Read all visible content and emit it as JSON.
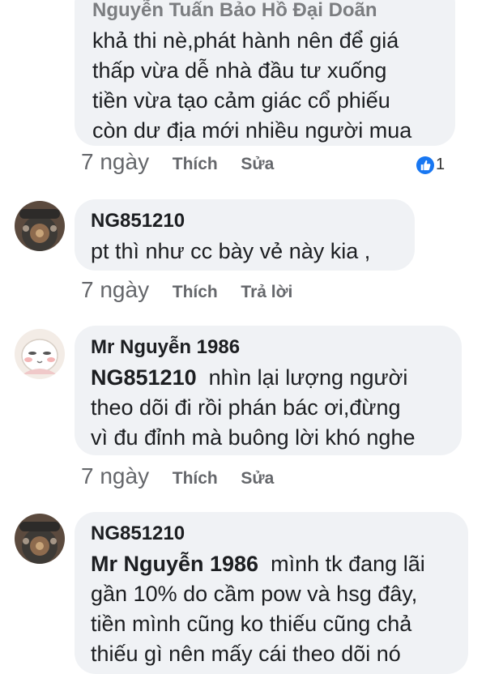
{
  "comment1": {
    "author_partial": "Nguyễn Tuấn Bảo Hồ Đại Doãn",
    "lines": [
      "khả thi nè,phát hành nên để giá",
      "thấp vừa dễ nhà đầu tư xuống",
      "tiền vừa tạo cảm giác cổ phiếu",
      "còn dư địa mới nhiều người mua"
    ],
    "time": "7 ngày",
    "like_label": "Thích",
    "edit_label": "Sửa",
    "reaction_count": "1",
    "reaction_icon": "like-icon"
  },
  "comment2": {
    "author": "NG851210",
    "lines": [
      "pt thì như cc bày vẻ này kia ,"
    ],
    "time": "7 ngày",
    "like_label": "Thích",
    "reply_label": "Trả lời"
  },
  "comment3": {
    "author": "Mr Nguyễn 1986",
    "mention": "NG851210",
    "lines": [
      "nhìn lại lượng người",
      "theo dõi đi rồi phán bác ơi,đừng",
      "vì đu đỉnh mà buông lời khó nghe"
    ],
    "time": "7 ngày",
    "like_label": "Thích",
    "edit_label": "Sửa"
  },
  "comment4": {
    "author": "NG851210",
    "mention": "Mr Nguyễn 1986",
    "lines": [
      "mình tk đang lãi",
      "gần 10% do cầm pow và hsg đây,",
      "tiền mình cũng ko thiếu cũng chả",
      "thiếu gì nên mấy cái theo dõi nó"
    ]
  },
  "colors": {
    "bubble": "#f0f2f5",
    "meta_text": "#65676b",
    "like_blue": "#1877f2"
  }
}
